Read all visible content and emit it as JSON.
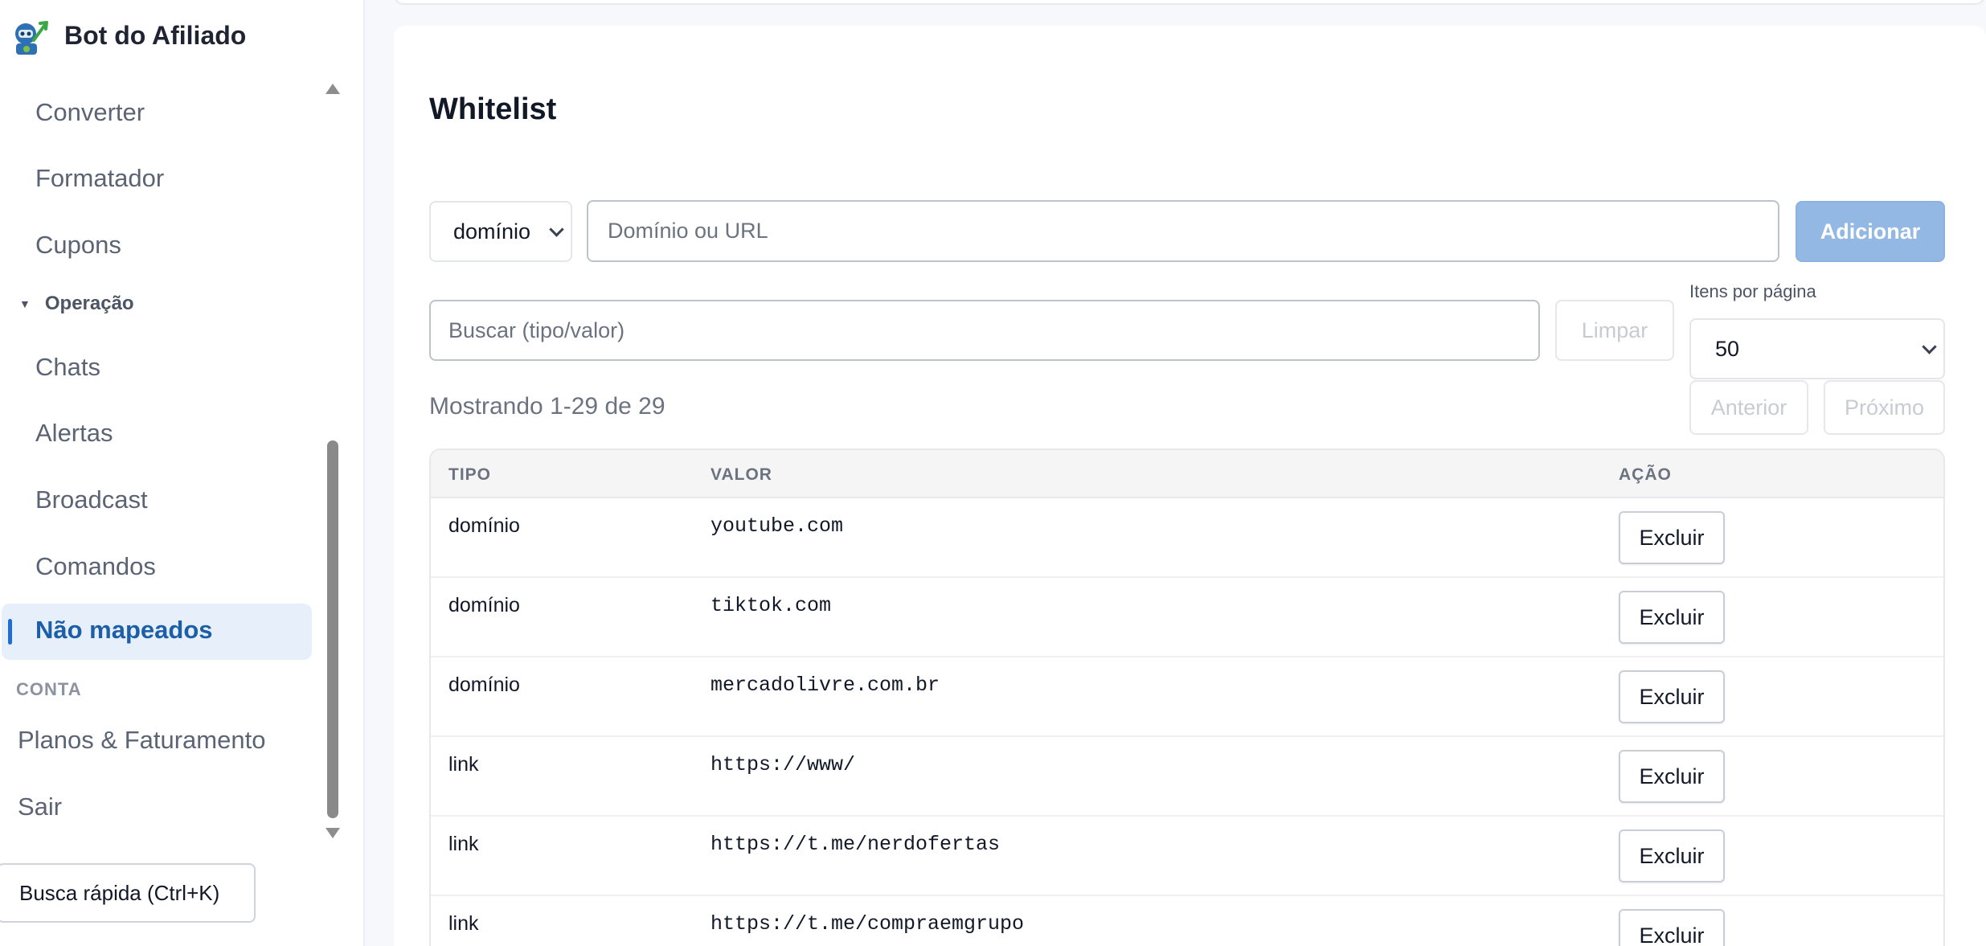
{
  "brand": {
    "name": "Bot do Afiliado"
  },
  "sidebar": {
    "items_top": [
      {
        "label": "Converter"
      },
      {
        "label": "Formatador"
      },
      {
        "label": "Cupons"
      }
    ],
    "group": {
      "label": "Operação"
    },
    "items_operacao": [
      {
        "label": "Chats"
      },
      {
        "label": "Alertas"
      },
      {
        "label": "Broadcast"
      },
      {
        "label": "Comandos"
      }
    ],
    "active_item": {
      "label": "Não mapeados"
    },
    "section": {
      "label": "CONTA"
    },
    "items_conta": [
      {
        "label": "Planos & Faturamento"
      },
      {
        "label": "Sair"
      }
    ],
    "quick_search": {
      "label": "Busca rápida (Ctrl+K)"
    }
  },
  "main": {
    "title": "Whitelist",
    "type_select": {
      "value": "domínio"
    },
    "url_input": {
      "placeholder": "Domínio ou URL"
    },
    "add_button": {
      "label": "Adicionar"
    },
    "search_input": {
      "placeholder": "Buscar (tipo/valor)"
    },
    "clear_button": {
      "label": "Limpar"
    },
    "per_page": {
      "label": "Itens por página",
      "value": "50"
    },
    "showing": "Mostrando 1-29 de 29",
    "prev_button": {
      "label": "Anterior"
    },
    "next_button": {
      "label": "Próximo"
    },
    "table": {
      "headers": {
        "type": "TIPO",
        "value": "VALOR",
        "action": "AÇÃO"
      },
      "rows": [
        {
          "type": "domínio",
          "value": "youtube.com",
          "action": "Excluir"
        },
        {
          "type": "domínio",
          "value": "tiktok.com",
          "action": "Excluir"
        },
        {
          "type": "domínio",
          "value": "mercadolivre.com.br",
          "action": "Excluir"
        },
        {
          "type": "link",
          "value": "https://www/",
          "action": "Excluir"
        },
        {
          "type": "link",
          "value": "https://t.me/nerdofertas",
          "action": "Excluir"
        },
        {
          "type": "link",
          "value": "https://t.me/compraemgrupo",
          "action": "Excluir"
        }
      ]
    }
  },
  "colors": {
    "accent": "#1f6ed4",
    "active_bg": "#e7f0fa",
    "add_button_bg": "#93b8e3"
  }
}
